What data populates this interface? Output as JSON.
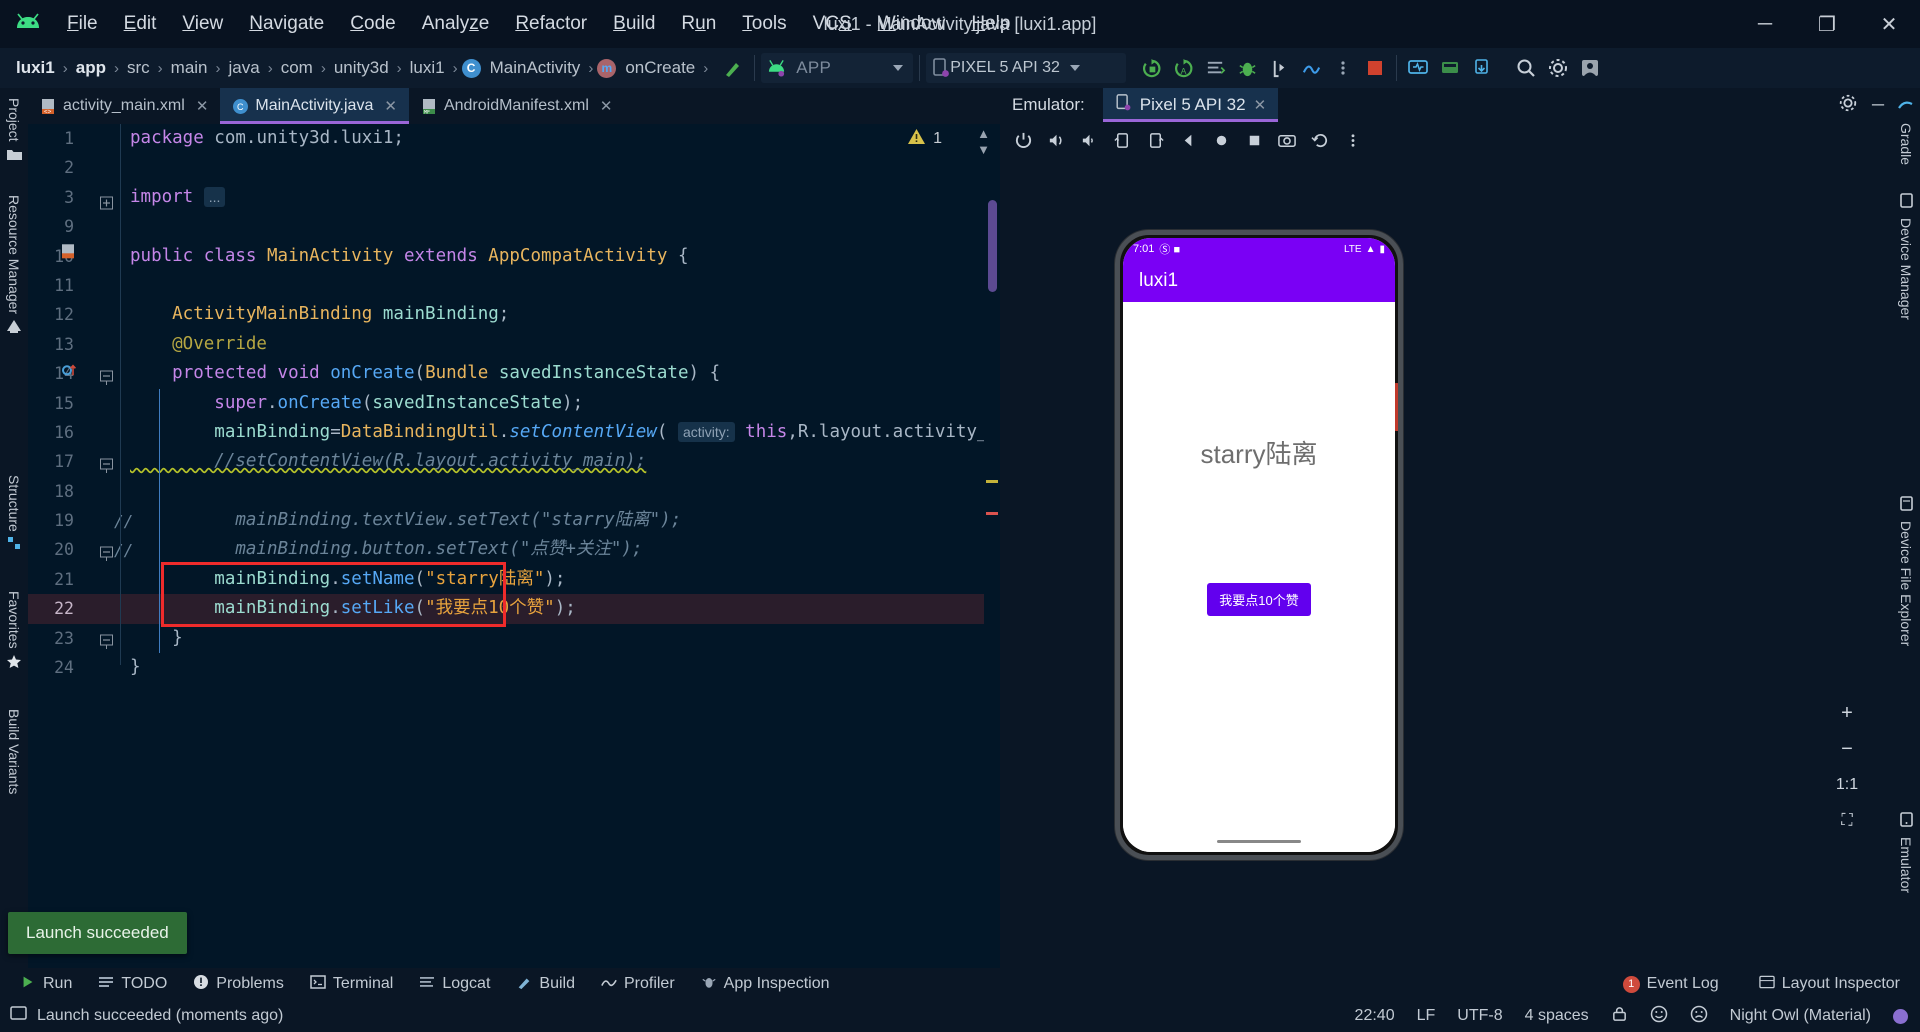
{
  "window": {
    "title": "luxi1 - MainActivity.java [luxi1.app]",
    "minimize": "─",
    "maximize": "❐",
    "close": "✕"
  },
  "menu": [
    {
      "label": "File",
      "mnemonic": "F"
    },
    {
      "label": "Edit",
      "mnemonic": "E"
    },
    {
      "label": "View",
      "mnemonic": "V"
    },
    {
      "label": "Navigate",
      "mnemonic": "N"
    },
    {
      "label": "Code",
      "mnemonic": "C"
    },
    {
      "label": "Analyze",
      "mnemonic": "A"
    },
    {
      "label": "Refactor",
      "mnemonic": "R"
    },
    {
      "label": "Build",
      "mnemonic": "B"
    },
    {
      "label": "Run",
      "mnemonic": "R"
    },
    {
      "label": "Tools",
      "mnemonic": "T"
    },
    {
      "label": "VCS",
      "mnemonic": "S"
    },
    {
      "label": "Window",
      "mnemonic": "W"
    },
    {
      "label": "Help",
      "mnemonic": "H"
    }
  ],
  "breadcrumb": {
    "items": [
      "luxi1",
      "app",
      "src",
      "main",
      "java",
      "com",
      "unity3d",
      "luxi1",
      "MainActivity",
      "onCreate"
    ],
    "separator": "›"
  },
  "toolbar": {
    "run_config": "APP",
    "device": "PIXEL 5 API 32",
    "icons": [
      "run-icon",
      "debug-icon",
      "run-with-coverage-icon",
      "profile-icon",
      "attach-debugger-icon",
      "apply-changes-icon",
      "sync-gradle-icon",
      "avd-manager-icon",
      "sdk-manager-icon",
      "search-icon",
      "settings-icon",
      "account-icon"
    ]
  },
  "editor": {
    "tabs": [
      {
        "label": "activity_main.xml",
        "icon": "xml-file-icon",
        "active": false
      },
      {
        "label": "MainActivity.java",
        "icon": "java-class-icon",
        "active": true
      },
      {
        "label": "AndroidManifest.xml",
        "icon": "manifest-file-icon",
        "active": false
      }
    ],
    "warning_count": "1",
    "lines": [
      {
        "num": "1",
        "segments": [
          {
            "t": "package",
            "c": "kw"
          },
          {
            "t": " com.unity3d.luxi1;",
            "c": "pln"
          }
        ]
      },
      {
        "num": "2",
        "segments": []
      },
      {
        "num": "3",
        "fold": true,
        "segments": [
          {
            "t": "import",
            "c": "kw"
          },
          {
            "t": " ",
            "c": "pln"
          },
          {
            "t": "...",
            "c": "hint"
          }
        ]
      },
      {
        "num": "9",
        "segments": []
      },
      {
        "num": "10",
        "segments": [
          {
            "t": "public",
            "c": "kw"
          },
          {
            "t": " ",
            "c": "pln"
          },
          {
            "t": "class",
            "c": "kw"
          },
          {
            "t": " ",
            "c": "pln"
          },
          {
            "t": "MainActivity",
            "c": "typ"
          },
          {
            "t": " ",
            "c": "pln"
          },
          {
            "t": "extends",
            "c": "kw"
          },
          {
            "t": " ",
            "c": "pln"
          },
          {
            "t": "AppCompatActivity",
            "c": "typ"
          },
          {
            "t": " {",
            "c": "pln"
          }
        ]
      },
      {
        "num": "11",
        "segments": []
      },
      {
        "num": "12",
        "segments": [
          {
            "t": "    ActivityMainBinding",
            "c": "typ"
          },
          {
            "t": " ",
            "c": "pln"
          },
          {
            "t": "mainBinding",
            "c": "fld"
          },
          {
            "t": ";",
            "c": "pln"
          }
        ]
      },
      {
        "num": "13",
        "segments": [
          {
            "t": "    @Override",
            "c": "anno"
          }
        ]
      },
      {
        "num": "14",
        "fold": true,
        "segments": [
          {
            "t": "    ",
            "c": "pln"
          },
          {
            "t": "protected",
            "c": "kw"
          },
          {
            "t": " ",
            "c": "pln"
          },
          {
            "t": "void",
            "c": "kw"
          },
          {
            "t": " ",
            "c": "pln"
          },
          {
            "t": "onCreate",
            "c": "mth"
          },
          {
            "t": "(",
            "c": "pln"
          },
          {
            "t": "Bundle",
            "c": "typ"
          },
          {
            "t": " ",
            "c": "pln"
          },
          {
            "t": "savedInstanceState",
            "c": "fld"
          },
          {
            "t": ") {",
            "c": "pln"
          }
        ]
      },
      {
        "num": "15",
        "segments": [
          {
            "t": "        ",
            "c": "pln"
          },
          {
            "t": "super",
            "c": "kw"
          },
          {
            "t": ".",
            "c": "pln"
          },
          {
            "t": "onCreate",
            "c": "mth"
          },
          {
            "t": "(",
            "c": "pln"
          },
          {
            "t": "savedInstanceState",
            "c": "fld"
          },
          {
            "t": ");",
            "c": "pln"
          }
        ]
      },
      {
        "num": "16",
        "segments": [
          {
            "t": "        ",
            "c": "pln"
          },
          {
            "t": "mainBinding",
            "c": "fld"
          },
          {
            "t": "=",
            "c": "pln"
          },
          {
            "t": "DataBindingUtil",
            "c": "typ"
          },
          {
            "t": ".",
            "c": "pln"
          },
          {
            "t": "setContentView",
            "c": "mthi"
          },
          {
            "t": "( ",
            "c": "pln"
          },
          {
            "t": "activity:",
            "c": "hintinline"
          },
          {
            "t": " ",
            "c": "pln"
          },
          {
            "t": "this",
            "c": "kw"
          },
          {
            "t": ",R.layout.activity_main);",
            "c": "pln"
          }
        ]
      },
      {
        "num": "17",
        "fold": true,
        "squiggle": true,
        "segments": [
          {
            "t": "        //setContentView(R.layout.activity_main);",
            "c": "cmt"
          }
        ]
      },
      {
        "num": "18",
        "segments": []
      },
      {
        "num": "19",
        "gutterComment": "//",
        "segments": [
          {
            "t": "          mainBinding.textView.setText(\"starry陆离\");",
            "c": "cmt"
          }
        ]
      },
      {
        "num": "20",
        "gutterComment": "//",
        "fold": true,
        "segments": [
          {
            "t": "          mainBinding.button.setText(\"点赞+关注\");",
            "c": "cmt"
          }
        ]
      },
      {
        "num": "21",
        "boxed": true,
        "segments": [
          {
            "t": "        ",
            "c": "pln"
          },
          {
            "t": "mainBinding",
            "c": "fld"
          },
          {
            "t": ".",
            "c": "pln"
          },
          {
            "t": "setName",
            "c": "mth"
          },
          {
            "t": "(",
            "c": "pln"
          },
          {
            "t": "\"starry陆离\"",
            "c": "str"
          },
          {
            "t": ");",
            "c": "pln"
          }
        ]
      },
      {
        "num": "22",
        "boxed": true,
        "cursor": true,
        "segments": [
          {
            "t": "        ",
            "c": "pln"
          },
          {
            "t": "mainBinding",
            "c": "fld"
          },
          {
            "t": ".",
            "c": "pln"
          },
          {
            "t": "setLike",
            "c": "mth"
          },
          {
            "t": "(",
            "c": "pln"
          },
          {
            "t": "\"我要点10个赞\"",
            "c": "str"
          },
          {
            "t": ");",
            "c": "pln"
          }
        ]
      },
      {
        "num": "23",
        "fold": true,
        "segments": [
          {
            "t": "    }",
            "c": "pln"
          }
        ]
      },
      {
        "num": "24",
        "segments": [
          {
            "t": "}",
            "c": "pln"
          }
        ]
      }
    ]
  },
  "left_stripe": [
    {
      "label": "Project",
      "icon": "project-icon"
    },
    {
      "label": "Resource Manager",
      "icon": "resource-icon"
    },
    {
      "label": "Structure",
      "icon": "structure-icon"
    },
    {
      "label": "Favorites",
      "icon": "star-icon"
    },
    {
      "label": "Build Variants",
      "icon": "variants-icon"
    }
  ],
  "right_stripe": [
    {
      "label": "Gradle",
      "icon": "gradle-icon"
    },
    {
      "label": "Device Manager",
      "icon": "device-manager-icon"
    },
    {
      "label": "Device File Explorer",
      "icon": "device-file-icon"
    },
    {
      "label": "Emulator",
      "icon": "emulator-icon"
    }
  ],
  "emulator": {
    "panel_label": "Emulator:",
    "tab_label": "Pixel 5 API 32",
    "close_icon": "✕",
    "settings_icon": "gear-icon",
    "minimize_icon": "─",
    "toolbar_icons": [
      "power-icon",
      "volume-up-icon",
      "volume-down-icon",
      "rotate-left-icon",
      "rotate-right-icon",
      "back-icon",
      "home-icon",
      "overview-icon",
      "screenshot-icon",
      "history-icon",
      "more-icon"
    ],
    "zoom_controls": [
      "zoom-in",
      "zoom-out",
      "actual-size",
      "fit-screen"
    ],
    "zoom_in_label": "+",
    "zoom_out_label": "−",
    "actual_size_label": "1:1",
    "fit_label": "⛶",
    "device": {
      "status_time": "7:01",
      "status_icons_left": "Ⓢ ■",
      "status_network": "LTE",
      "app_bar_title": "luxi1",
      "text_view": "starry陆离",
      "button_label": "我要点10个赞"
    }
  },
  "toast": {
    "message": "Launch succeeded"
  },
  "toolwindows": {
    "left": [
      {
        "label": "Run",
        "icon": "run-icon"
      },
      {
        "label": "TODO",
        "icon": "todo-icon"
      },
      {
        "label": "Problems",
        "icon": "problems-icon"
      },
      {
        "label": "Terminal",
        "icon": "terminal-icon"
      },
      {
        "label": "Logcat",
        "icon": "logcat-icon"
      },
      {
        "label": "Build",
        "icon": "build-icon"
      },
      {
        "label": "Profiler",
        "icon": "profiler-icon"
      },
      {
        "label": "App Inspection",
        "icon": "app-inspection-icon"
      }
    ],
    "right": [
      {
        "label": "Event Log",
        "icon": "event-log-icon",
        "badge": "1"
      },
      {
        "label": "Layout Inspector",
        "icon": "layout-inspector-icon"
      }
    ]
  },
  "statusbar": {
    "message": "Launch succeeded (moments ago)",
    "position": "22:40",
    "line_sep": "LF",
    "encoding": "UTF-8",
    "indent": "4 spaces",
    "lock_icon": "lock-icon",
    "theme": "Night Owl (Material)"
  },
  "colors": {
    "accent_purple": "#9a66d8",
    "app_purple": "#7a00f5",
    "highlight_red": "#ef2b2b",
    "success_green": "#2d6b35",
    "editor_bg": "#021627"
  }
}
